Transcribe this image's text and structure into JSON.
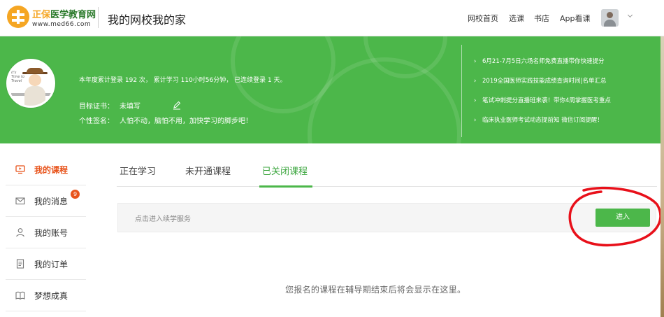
{
  "header": {
    "brand_part1": "正保",
    "brand_part2": "医学教育网",
    "brand_url": "www.med66.com",
    "site_title": "我的网校我的家",
    "nav": [
      "网校首页",
      "选课",
      "书店",
      "App看课"
    ]
  },
  "banner": {
    "stats": "本年度累计登录 192 次， 累计学习 110小时56分钟， 已连续登录 1 天。",
    "goal_label": "目标证书：",
    "goal_value": "未填写",
    "sig_label": "个性签名：",
    "sig_value": "人怕不动，脑怕不用，加快学习的脚步吧！",
    "news": [
      "6月21-7月5日六场名师免费直播带你快速提分",
      "2019全国医师实践技能成绩查询时间|名单汇总",
      "笔试冲刺提分直播班来袭！带你4周掌握医考重点",
      "临床执业医师考试动态提前知 微信订阅提醒！"
    ],
    "avatar_text": "It's Time to Travel",
    "color": "#4cb74a"
  },
  "sidebar": {
    "items": [
      {
        "label": "我的课程",
        "icon": "monitor-icon",
        "active": true
      },
      {
        "label": "我的消息",
        "icon": "envelope-icon",
        "badge": "9"
      },
      {
        "label": "我的账号",
        "icon": "user-icon"
      },
      {
        "label": "我的订单",
        "icon": "document-icon"
      },
      {
        "label": "梦想成真",
        "icon": "book-icon"
      }
    ]
  },
  "tabs": [
    "正在学习",
    "未开通课程",
    "已关闭课程"
  ],
  "active_tab": "已关闭课程",
  "service": {
    "text": "点击进入续学服务",
    "button": "进入"
  },
  "empty_message": "您报名的课程在辅导期结束后将会显示在这里。",
  "colors": {
    "accent_green": "#4cb74a",
    "active_orange": "#e8541c",
    "annotation_red": "#e8101a"
  }
}
